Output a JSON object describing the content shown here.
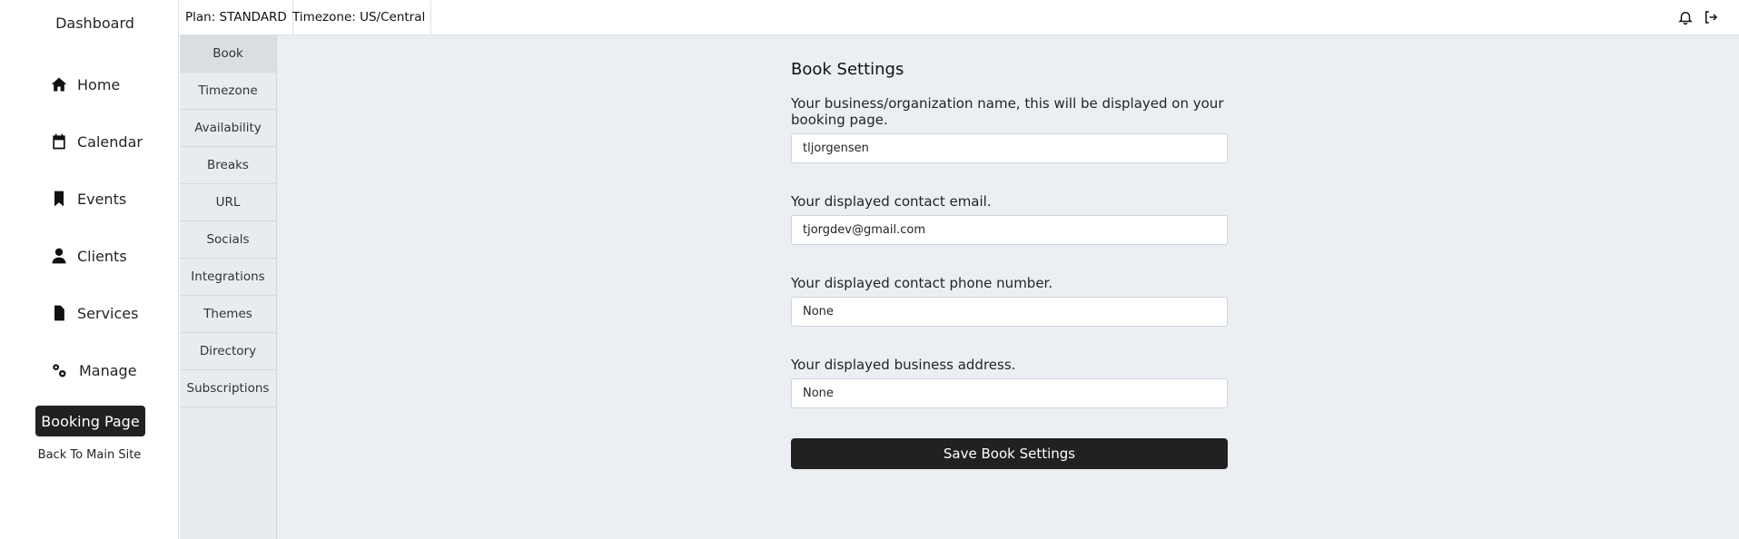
{
  "sidebar": {
    "title": "Dashboard",
    "items": [
      {
        "label": "Home",
        "icon": "home-icon"
      },
      {
        "label": "Calendar",
        "icon": "calendar-icon"
      },
      {
        "label": "Events",
        "icon": "bookmark-icon"
      },
      {
        "label": "Clients",
        "icon": "user-icon"
      },
      {
        "label": "Services",
        "icon": "file-icon"
      },
      {
        "label": "Manage",
        "icon": "gears-icon"
      }
    ],
    "booking_button": "Booking Page",
    "back_link": "Back To Main Site"
  },
  "topbar": {
    "plan": "Plan: STANDARD",
    "timezone": "Timezone: US/Central"
  },
  "subnav": {
    "items": [
      "Book",
      "Timezone",
      "Availability",
      "Breaks",
      "URL",
      "Socials",
      "Integrations",
      "Themes",
      "Directory",
      "Subscriptions"
    ],
    "active": "Book"
  },
  "form": {
    "title": "Book Settings",
    "fields": [
      {
        "label": "Your business/organization name, this will be displayed on your booking page.",
        "value": "tljorgensen"
      },
      {
        "label": "Your displayed contact email.",
        "value": "tjorgdev@gmail.com"
      },
      {
        "label": "Your displayed contact phone number.",
        "value": "None"
      },
      {
        "label": "Your displayed business address.",
        "value": "None"
      }
    ],
    "save_label": "Save Book Settings"
  }
}
